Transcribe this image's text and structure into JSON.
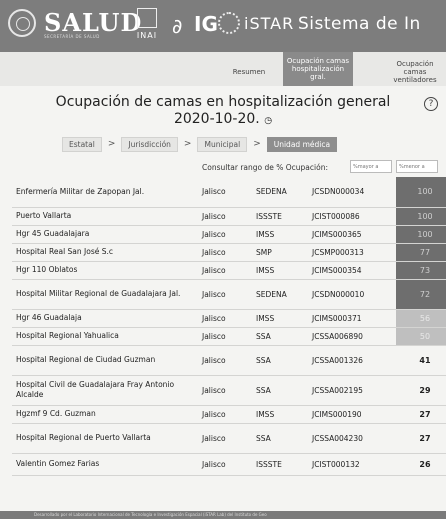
{
  "header": {
    "logo_salud": "SALUD",
    "logo_salud_sub": "SECRETARÍA DE SALUD",
    "logo_inai": "INAI",
    "logo_ig": "IG",
    "logo_istar": "iSTAR",
    "system_title": "Sistema de In"
  },
  "tabs": [
    {
      "label": "Resumen",
      "active": false
    },
    {
      "label": "Ocupación camas hospitalización gral.",
      "active": true
    },
    {
      "label": "Ocupación camas ventiladores",
      "active": false
    }
  ],
  "page": {
    "title_line1": "Ocupación de camas en hospitalización general",
    "title_line2": "2020-10-20.",
    "title_icon": "clock-icon",
    "help_icon": "?"
  },
  "breadcrumb": {
    "items": [
      "Estatal",
      "Jurisdicción",
      "Municipal",
      "Unidad médica"
    ],
    "separator": ">"
  },
  "filter": {
    "label": "Consultar rango de % Ocupación:",
    "min_placeholder": "%mayor a",
    "max_placeholder": "%menor a"
  },
  "colors": {
    "header_bg": "#7d7d7d",
    "high_occupancy": "#6e6e6e",
    "mid_occupancy": "#888888",
    "low_occupancy": "#bfbfbf"
  },
  "rows": [
    {
      "name": "Enfermería Militar de Zapopan Jal.",
      "state": "Jalisco",
      "inst": "SEDENA",
      "clues": "JCSDN000034",
      "value": "100"
    },
    {
      "name": "Puerto Vallarta",
      "state": "Jalisco",
      "inst": "ISSSTE",
      "clues": "JCIST000086",
      "value": "100"
    },
    {
      "name": "Hgr 45 Guadalajara",
      "state": "Jalisco",
      "inst": "IMSS",
      "clues": "JCIMS000365",
      "value": "100"
    },
    {
      "name": "Hospital Real San José S.c",
      "state": "Jalisco",
      "inst": "SMP",
      "clues": "JCSMP000313",
      "value": "77"
    },
    {
      "name": "Hgr 110 Oblatos",
      "state": "Jalisco",
      "inst": "IMSS",
      "clues": "JCIMS000354",
      "value": "73"
    },
    {
      "name": "Hospital Militar Regional de Guadalajara Jal.",
      "state": "Jalisco",
      "inst": "SEDENA",
      "clues": "JCSDN000010",
      "value": "72"
    },
    {
      "name": "Hgr 46 Guadalaja",
      "state": "Jalisco",
      "inst": "IMSS",
      "clues": "JCIMS000371",
      "value": "56"
    },
    {
      "name": "Hospital Regional Yahualica",
      "state": "Jalisco",
      "inst": "SSA",
      "clues": "JCSSA006890",
      "value": "50"
    },
    {
      "name": "Hospital Regional de Ciudad Guzman",
      "state": "Jalisco",
      "inst": "SSA",
      "clues": "JCSSA001326",
      "value": "41"
    },
    {
      "name": "Hospital Civil de Guadalajara Fray Antonio Alcalde",
      "state": "Jalisco",
      "inst": "SSA",
      "clues": "JCSSA002195",
      "value": "29"
    },
    {
      "name": "Hgzmf 9 Cd. Guzman",
      "state": "Jalisco",
      "inst": "IMSS",
      "clues": "JCIMS000190",
      "value": "27"
    },
    {
      "name": "Hospital Regional de Puerto Vallarta",
      "state": "Jalisco",
      "inst": "SSA",
      "clues": "JCSSA004230",
      "value": "27"
    },
    {
      "name": "Valentin Gomez Farias",
      "state": "Jalisco",
      "inst": "ISSSTE",
      "clues": "JCIST000132",
      "value": "26"
    }
  ],
  "footer": {
    "text": "Desarrollado por el Laboratorio Internacional de Tecnología e Investigación Espacial (iSTAR Lab) del Instituto de Geo"
  }
}
